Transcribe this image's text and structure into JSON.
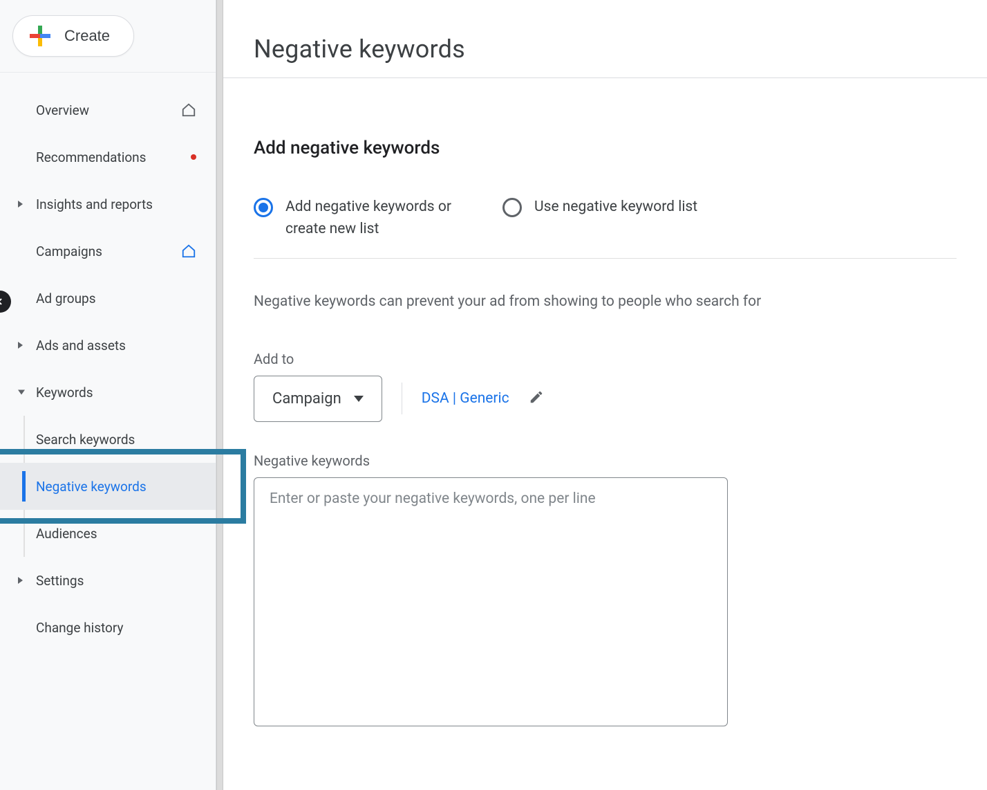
{
  "sidebar": {
    "create_label": "Create",
    "items": [
      {
        "label": "Overview"
      },
      {
        "label": "Recommendations"
      },
      {
        "label": "Insights and reports"
      },
      {
        "label": "Campaigns"
      },
      {
        "label": "Ad groups"
      },
      {
        "label": "Ads and assets"
      },
      {
        "label": "Keywords"
      },
      {
        "label": "Settings"
      },
      {
        "label": "Change history"
      }
    ],
    "keywords_sub": [
      {
        "label": "Search keywords"
      },
      {
        "label": "Negative keywords"
      },
      {
        "label": "Audiences"
      }
    ]
  },
  "main": {
    "page_title": "Negative keywords",
    "section_title": "Add negative keywords",
    "radio": {
      "opt1": "Add negative keywords or create new list",
      "opt2": "Use negative keyword list"
    },
    "help_text": "Negative keywords can prevent your ad from showing to people who search for",
    "add_to_label": "Add to",
    "add_to_dropdown": "Campaign",
    "target_link": "DSA | Generic",
    "neg_kw_label": "Negative keywords",
    "neg_kw_placeholder": "Enter or paste your negative keywords, one per line"
  },
  "colors": {
    "accent": "#1a73e8",
    "highlight": "#2b7ca1"
  }
}
